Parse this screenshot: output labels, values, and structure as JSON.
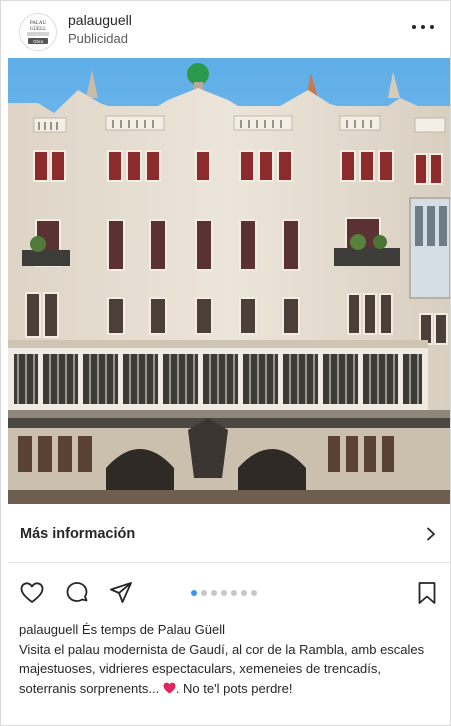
{
  "post": {
    "username": "palauguell",
    "sponsored_label": "Publicidad",
    "avatar_text": {
      "line1": "PALAU",
      "line2": "GÜELL",
      "badge": "Obra"
    },
    "more_options_icon": "ellipsis-icon"
  },
  "cta": {
    "label": "Más información",
    "icon": "chevron-right-icon"
  },
  "actions": {
    "like_icon": "heart-icon",
    "comment_icon": "comment-icon",
    "share_icon": "send-icon",
    "save_icon": "bookmark-icon",
    "carousel_total": 7,
    "carousel_active": 1,
    "carousel_active_color": "#3897f0"
  },
  "caption": {
    "username": "palauguell",
    "headline": "És temps de Palau Güell",
    "body_1": "Visita el palau modernista de Gaudí, al cor de la Rambla, amb escales majestuoses, vidrieres espectaculars, xemeneies de trencadís, soterranis sorprenents...",
    "emoji": "heart-eyes-emoji",
    "body_2": ". No te'l pots perdre!"
  },
  "colors": {
    "sky": "#76b7ea",
    "facade": "#e9e1d4",
    "text": "#262626"
  }
}
